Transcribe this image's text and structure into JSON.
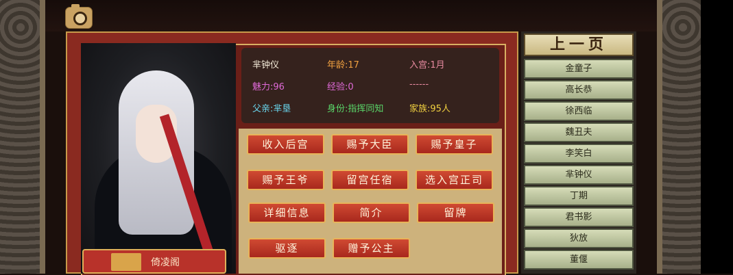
{
  "colors": {
    "accent_red": "#b8322a",
    "gold": "#d9b063",
    "list_green": "#c2c9a2"
  },
  "portrait": {
    "plaque_label": "倚凌阁"
  },
  "info": {
    "name": "芈钟仪",
    "age": "年龄:17",
    "entered": "入宫:1月",
    "charm": "魅力:96",
    "experience": "经验:0",
    "dash": "------",
    "father": "父亲:芈垦",
    "identity": "身份:指挥同知",
    "family": "家族:95人"
  },
  "actions": [
    {
      "label": "收入后宫"
    },
    {
      "label": "赐予大臣"
    },
    {
      "label": "赐予皇子"
    },
    {
      "label": "赐予王爷"
    },
    {
      "label": "留宫任宿"
    },
    {
      "label": "选入宫正司"
    },
    {
      "label": "详细信息"
    },
    {
      "label": "简介"
    },
    {
      "label": "留牌"
    },
    {
      "label": "驱逐"
    },
    {
      "label": "赠予公主"
    }
  ],
  "list": {
    "prev_page": "上一页",
    "items": [
      "金童子",
      "高长恭",
      "徐西临",
      "魏丑夫",
      "李笑白",
      "芈钟仪",
      "丁期",
      "君书影",
      "狄放",
      "董偃"
    ]
  },
  "icons": {
    "camera": "camera-icon"
  }
}
